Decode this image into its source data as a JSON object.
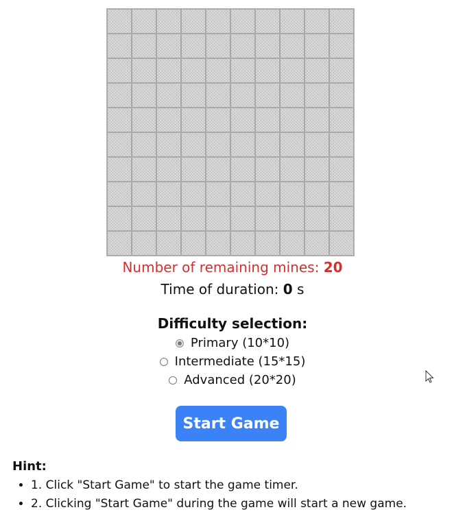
{
  "game": {
    "rows": 10,
    "cols": 10
  },
  "status": {
    "remaining_label": "Number of remaining mines: ",
    "remaining_value": "20",
    "time_label": "Time of duration: ",
    "time_value": "0",
    "time_unit": " s"
  },
  "difficulty": {
    "title": "Difficulty selection:",
    "options": [
      {
        "label": "Primary (10*10)",
        "checked": true
      },
      {
        "label": "Intermediate (15*15)",
        "checked": false
      },
      {
        "label": "Advanced (20*20)",
        "checked": false
      }
    ]
  },
  "controls": {
    "start_label": "Start Game",
    "accent_color": "#3b82f6"
  },
  "hint": {
    "title": "Hint:",
    "items": [
      "1. Click \"Start Game\" to start the game timer.",
      "2. Clicking \"Start Game\" during the game will start a new game."
    ]
  },
  "colors": {
    "remaining_text": "#d32f2f"
  }
}
